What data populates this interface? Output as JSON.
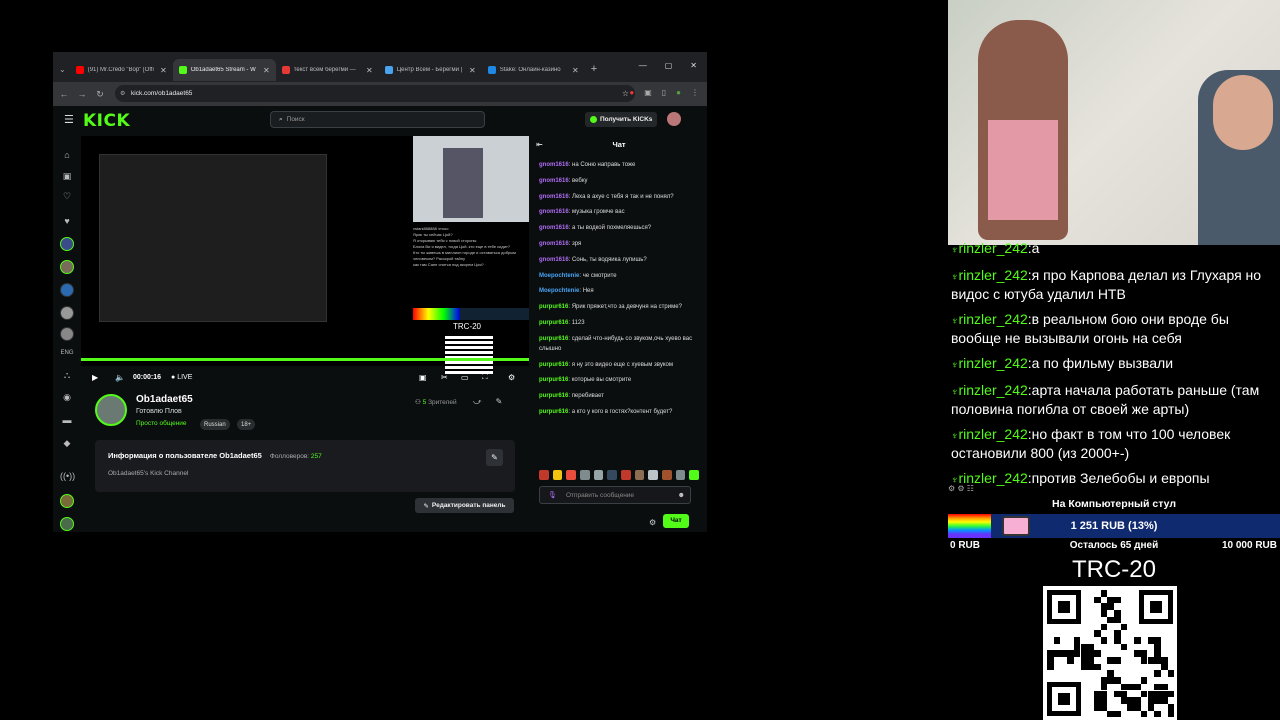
{
  "browser": {
    "tabs": [
      {
        "title": "(91) Mr.Credo \"Вор\" [Offi",
        "favicon_color": "#ff0000"
      },
      {
        "title": "Ob1adaet65 Stream - W",
        "favicon_color": "#53fc18"
      },
      {
        "title": "текст всем берегми — ",
        "favicon_color": "#e53935"
      },
      {
        "title": "Центр Всем - Берегми | ",
        "favicon_color": "#4aa3f0"
      },
      {
        "title": "Stake: Онлайн-казино ",
        "favicon_color": "#1e88e5"
      }
    ],
    "active_tab": 1,
    "url": "kick.com/ob1adaet65",
    "new_tab": "+",
    "window_controls": [
      "—",
      "▢",
      "✕"
    ]
  },
  "kick": {
    "logo": "KICK",
    "search_placeholder": "Поиск",
    "get_kicks": "Получить KICKs",
    "player": {
      "time": "00:00:16",
      "live": "LIVE",
      "mini_trc": "TRC-20",
      "mini_chat": [
        "vstanі888888 чтооо",
        "Ярик ты сейчас Цой?",
        "Я открываю тебя с новой стороны",
        "Блоха Ви я видел, тогда Цой. кто еще в тебе сидит?",
        "Кто ты живешь в миллион городе и оставаться добрым человеком? Расскрой тайну",
        "как там Сане спится под якорем Цоя?"
      ]
    },
    "channel": {
      "name": "Ob1adaet65",
      "title": "Готовлю Плов",
      "category": "Просто общение",
      "tags": [
        "Russian",
        "18+"
      ],
      "viewers_count": "5",
      "viewers_label": "Зрителей",
      "about_title": "Информация о пользователе Ob1adaet65",
      "followers_label": "Фолловеров:",
      "followers_count": "257",
      "about_desc": "Ob1adaet65's Kick Channel",
      "edit_panel": "Редактировать панель"
    },
    "chat": {
      "title": "Чат",
      "messages": [
        {
          "user": "gnom1616",
          "text": "на Соню направь тоже",
          "color": "#b06cf5"
        },
        {
          "user": "gnom1616",
          "text": "вебку",
          "color": "#b06cf5"
        },
        {
          "user": "gnom1616",
          "text": "Леха в ахуе с тебя я так и не понял?",
          "color": "#b06cf5"
        },
        {
          "user": "gnom1616",
          "text": "музыка громче вас",
          "color": "#b06cf5"
        },
        {
          "user": "gnom1616",
          "text": "а ты водкой похмеляешься?",
          "color": "#b06cf5"
        },
        {
          "user": "gnom1616",
          "text": "зря",
          "color": "#b06cf5"
        },
        {
          "user": "gnom1616",
          "text": "Сонь, ты водяика лупишь?",
          "color": "#b06cf5"
        },
        {
          "user": "Moepochtenie",
          "text": "че смотрите",
          "color": "#4aa3f0"
        },
        {
          "user": "Moepochtenie",
          "text": "Нея",
          "color": "#4aa3f0"
        },
        {
          "user": "purpur616",
          "text": "Ярик пряжет,что за девчуня на стриме?",
          "color": "#53fc18"
        },
        {
          "user": "purpur616",
          "text": "1123",
          "color": "#53fc18"
        },
        {
          "user": "purpur616",
          "text": "сделай что-нибудь со звуком,очь хуево вас слышно",
          "color": "#53fc18"
        },
        {
          "user": "purpur616",
          "text": "я ну это видео еще с хуевым звуком",
          "color": "#53fc18"
        },
        {
          "user": "purpur616",
          "text": "которые вы смотрите",
          "color": "#53fc18"
        },
        {
          "user": "purpur616",
          "text": "перебивает",
          "color": "#53fc18"
        },
        {
          "user": "purpur616",
          "text": "а кто у кого в гостях?контент будет?",
          "color": "#53fc18"
        }
      ],
      "emote_colors": [
        "#c0392b",
        "#f1c40f",
        "#e74c3c",
        "#7f8c8d",
        "#95a5a6",
        "#34495e",
        "#c0392b",
        "#8e6e53",
        "#bdc3c7",
        "#a0522d",
        "#7f8c8d",
        "#53fc18"
      ],
      "input_placeholder": "Отправить сообщение",
      "send": "Чат"
    }
  },
  "overlay": {
    "chat": [
      {
        "user": "rinzler_242",
        "text": "а"
      },
      {
        "user": "rinzler_242",
        "text": "я про Карпова делал из Глухаря но видос с ютуба удалил НТВ"
      },
      {
        "user": "rinzler_242",
        "text": "в реальном бою они вроде бы вообще не вызывали огонь на себя"
      },
      {
        "user": "rinzler_242",
        "text": "а по фильму вызвали"
      },
      {
        "user": "rinzler_242",
        "text": "арта начала работать раньше (там половина погибла от своей же арты)"
      },
      {
        "user": "rinzler_242",
        "text": "но факт в том что 100 человек остановили 800 (из 2000+-)"
      },
      {
        "user": "rinzler_242",
        "text": "против Зелебобы и европы"
      }
    ],
    "goal": {
      "title": "На Компьютерный стул",
      "amount": "1 251 RUB (13%)",
      "progress_fraction": 0.13,
      "min": "0 RUB",
      "remaining": "Осталось 65 дней",
      "max": "10 000 RUB"
    },
    "trc": "TRC-20",
    "accent": "#53fc18"
  }
}
